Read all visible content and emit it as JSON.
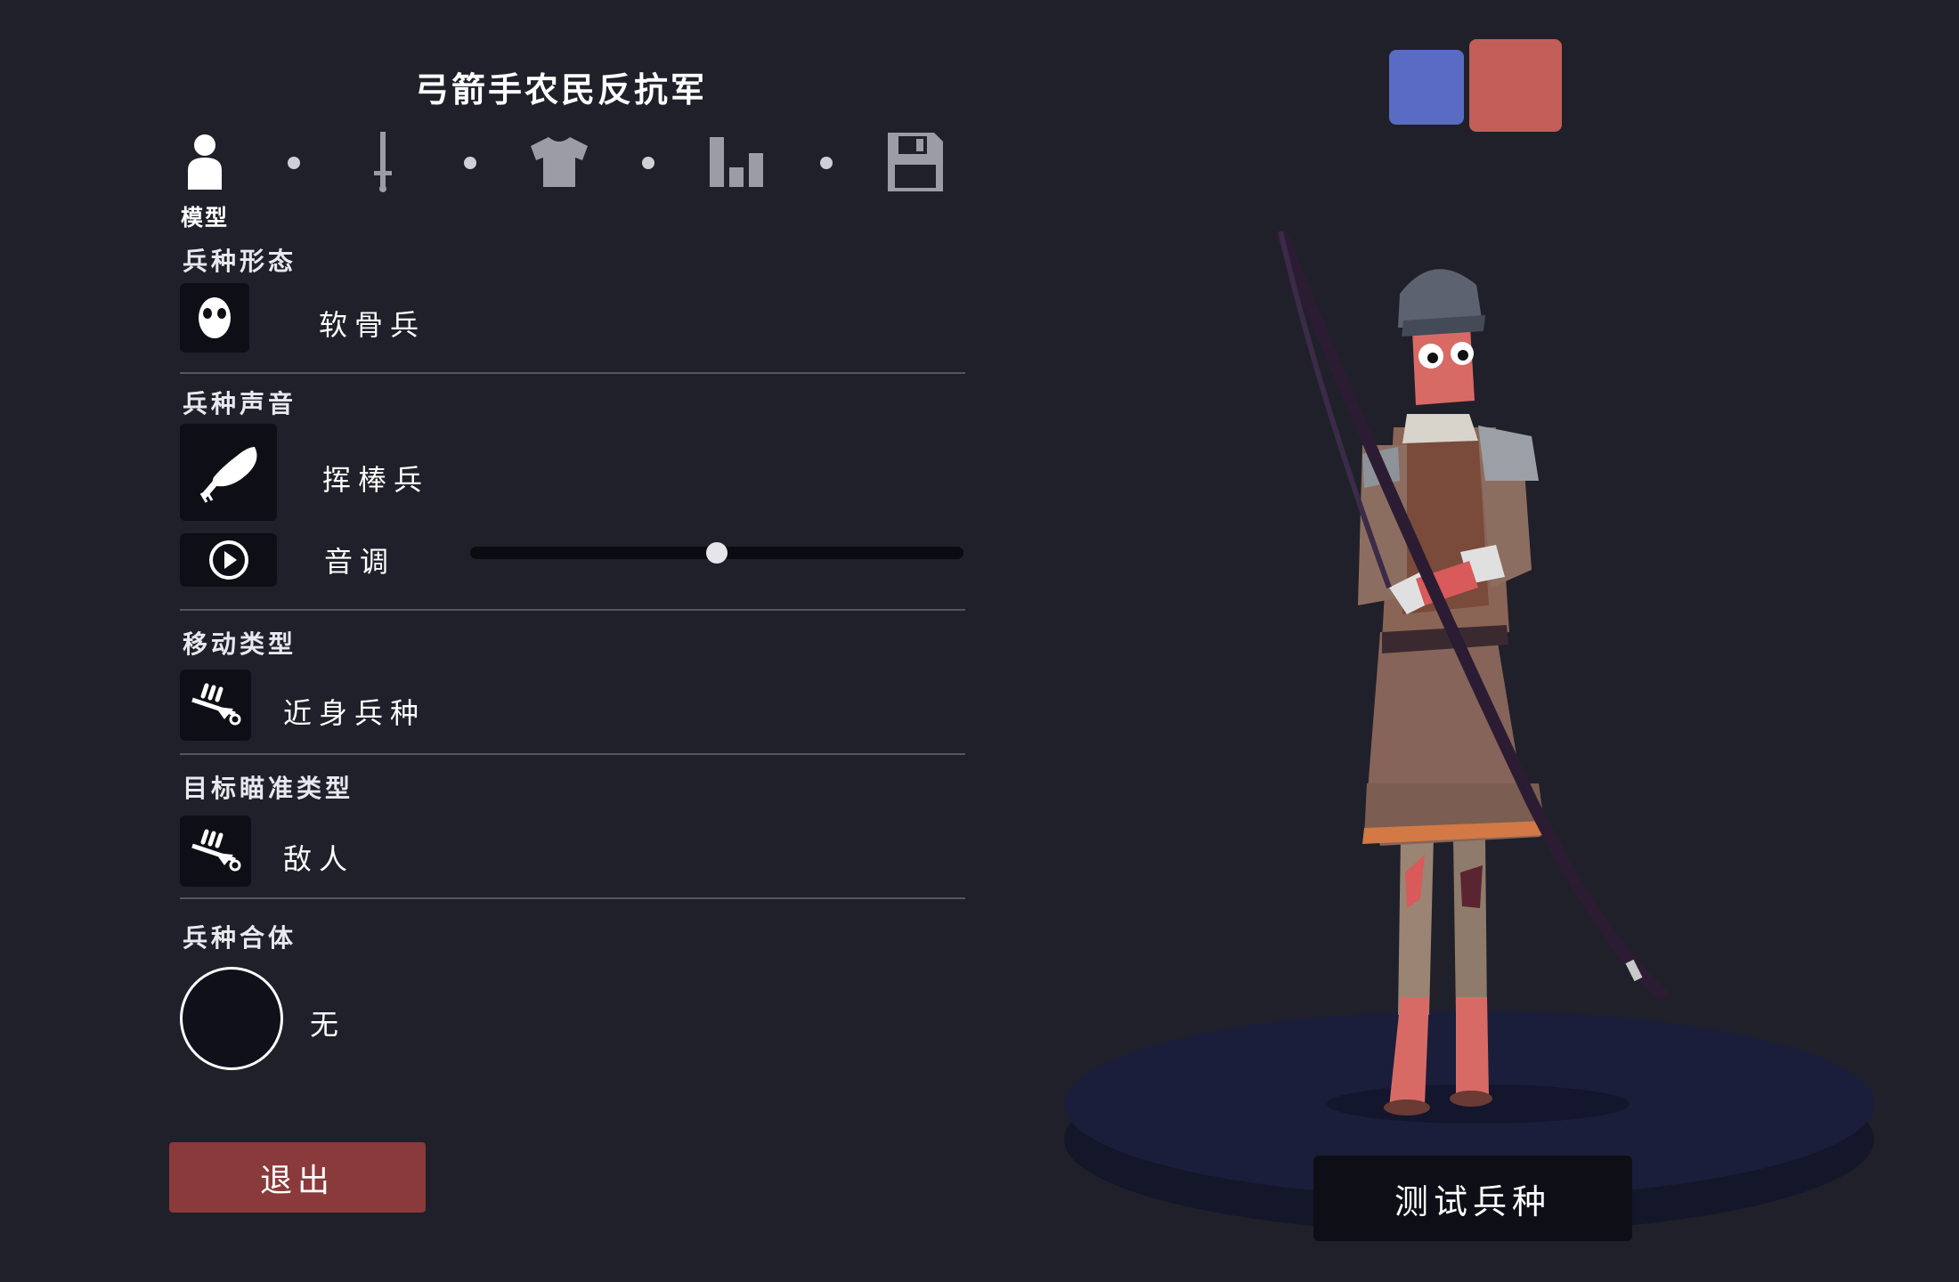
{
  "unit_name": "弓箭手农民反抗军",
  "steps": {
    "active_label": "模型",
    "items": [
      "person-icon",
      "sword-icon",
      "shirt-icon",
      "stats-icon",
      "save-icon"
    ]
  },
  "sections": {
    "unit_form": {
      "label": "兵种形态",
      "value": "软骨兵"
    },
    "unit_voice": {
      "label": "兵种声音",
      "value": "挥棒兵",
      "pitch_label": "音调",
      "pitch_level": 0.5
    },
    "movement_type": {
      "label": "移动类型",
      "value": "近身兵种"
    },
    "target_type": {
      "label": "目标瞄准类型",
      "value": "敌人"
    },
    "unit_combo": {
      "label": "兵种合体",
      "value": "无"
    }
  },
  "exit_label": "退出",
  "test_label": "测试兵种",
  "team_colors": {
    "blue": "#5a6bc4",
    "red": "#c25e57"
  },
  "colors": {
    "background": "#20202a",
    "exit_button": "#8a3a3a"
  }
}
